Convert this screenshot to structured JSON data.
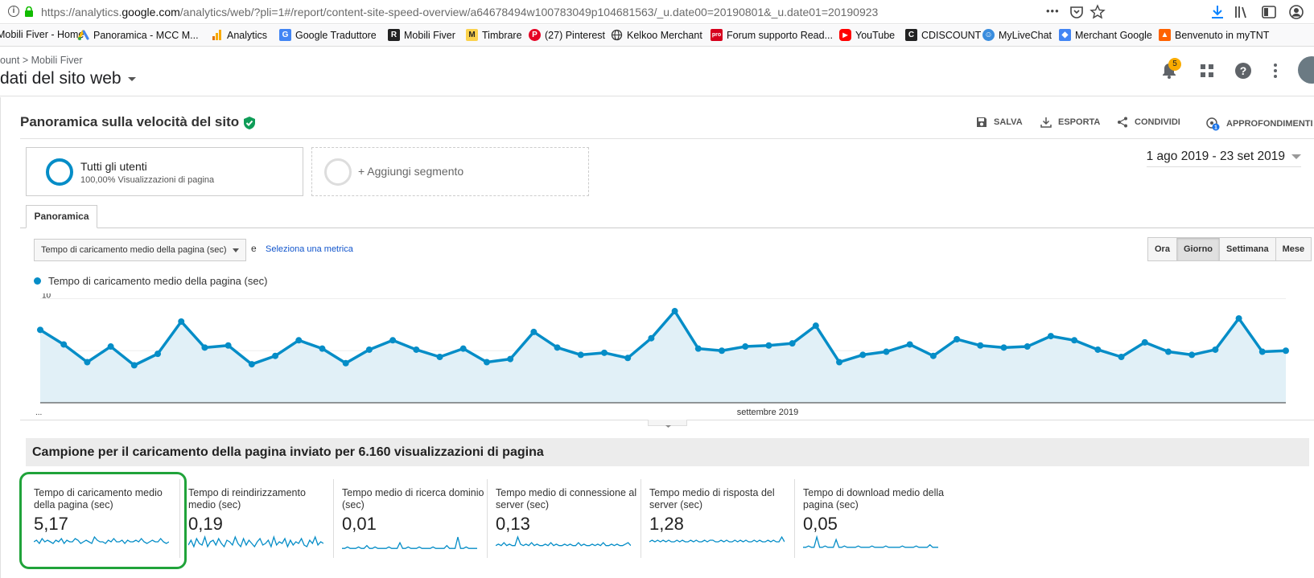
{
  "browser": {
    "url_prefix": "https://analytics.",
    "url_domain": "google.com",
    "url_rest": "/analytics/web/?pli=1#/report/content-site-speed-overview/a64678494w100783049p104681563/_u.date00=20190801&_u.date01=20190923",
    "menu_dots": "•••",
    "bookmarks": [
      {
        "label": "Mobili Fiver - Home",
        "icon": "mobili-icon"
      },
      {
        "label": "Panoramica - MCC M...",
        "icon": "google-ads-icon"
      },
      {
        "label": "Analytics",
        "icon": "analytics-icon"
      },
      {
        "label": "Google Traduttore",
        "icon": "translate-icon"
      },
      {
        "label": "Mobili Fiver",
        "icon": "mobili-icon"
      },
      {
        "label": "Timbrare",
        "icon": "timbrare-icon"
      },
      {
        "label": "(27) Pinterest",
        "icon": "pinterest-icon"
      },
      {
        "label": "Kelkoo Merchant",
        "icon": "globe-icon"
      },
      {
        "label": "Forum supporto Read...",
        "icon": "pro-icon"
      },
      {
        "label": "YouTube",
        "icon": "youtube-icon"
      },
      {
        "label": "CDISCOUNT",
        "icon": "cdiscount-icon"
      },
      {
        "label": "MyLiveChat",
        "icon": "mylivechat-icon"
      },
      {
        "label": "Merchant Google",
        "icon": "merchant-icon"
      },
      {
        "label": "Benvenuto in myTNT",
        "icon": "tnt-icon"
      }
    ]
  },
  "header": {
    "breadcrumb_account": "ount",
    "breadcrumb_property": "Mobili Fiver",
    "view_title": "dati del sito web",
    "notification_count": "5"
  },
  "report": {
    "title": "Panoramica sulla velocità del sito",
    "actions": {
      "save": "SALVA",
      "export": "ESPORTA",
      "share": "CONDIVIDI",
      "insights": "APPROFONDIMENTI"
    },
    "segment": {
      "name": "Tutti gli utenti",
      "subtitle": "100,00% Visualizzazioni di pagina"
    },
    "add_segment": "+ Aggiungi segmento",
    "date_range": "1 ago 2019 - 23 set 2019",
    "tab": "Panoramica",
    "metric_selector": "Tempo di caricamento medio della pagina (sec)",
    "and_text": "e",
    "select_metric": "Seleziona una metrica",
    "granularity": [
      "Ora",
      "Giorno",
      "Settimana",
      "Mese"
    ],
    "granularity_selected": "Giorno",
    "legend_label": "Tempo di caricamento medio della pagina (sec)",
    "sample_title": "Campione per il caricamento della pagina inviato per 6.160 visualizzazioni di pagina"
  },
  "colors": {
    "series": "#058dc7",
    "area_fill": "#e1f0f7",
    "highlight_border": "#20a33a"
  },
  "chart_data": {
    "type": "area",
    "series": [
      {
        "name": "Tempo di caricamento medio della pagina (sec)",
        "values": [
          7.0,
          5.6,
          3.9,
          5.4,
          3.6,
          4.7,
          7.8,
          5.3,
          5.5,
          3.7,
          4.5,
          6.0,
          5.2,
          3.8,
          5.1,
          6.0,
          5.1,
          4.4,
          5.2,
          3.9,
          4.2,
          6.8,
          5.3,
          4.6,
          4.8,
          4.3,
          6.2,
          8.8,
          5.2,
          5.0,
          5.4,
          5.5,
          5.7,
          7.4,
          3.9,
          4.6,
          4.9,
          5.6,
          4.5,
          6.1,
          5.5,
          5.3,
          5.4,
          6.4,
          6.0,
          5.1,
          4.4,
          5.8,
          4.9,
          4.6,
          5.1,
          8.1,
          4.9,
          5.0
        ]
      }
    ],
    "y_ticks": [
      "10",
      "5"
    ],
    "ylim": [
      0,
      10.5
    ],
    "x_labels": [
      "...",
      "settembre 2019"
    ],
    "grid": true
  },
  "scorecards": [
    {
      "title": "Tempo di caricamento medio della pagina (sec)",
      "value": "5,17",
      "spark": [
        5,
        6,
        4,
        7,
        5,
        6,
        5,
        4,
        6,
        5,
        7,
        4,
        6,
        5,
        5,
        7,
        6,
        4,
        5,
        6,
        5,
        4,
        8,
        6,
        5,
        5,
        4,
        6,
        5,
        7,
        5,
        5,
        6,
        4,
        6,
        5,
        5,
        6,
        5,
        7,
        5,
        4,
        5,
        6,
        5,
        5,
        7,
        5,
        4,
        5
      ]
    },
    {
      "title": "Tempo di reindirizzamento medio (sec)",
      "value": "0,19",
      "spark": [
        3,
        6,
        2,
        7,
        4,
        3,
        8,
        2,
        5,
        6,
        3,
        7,
        4,
        2,
        6,
        5,
        3,
        8,
        4,
        2,
        7,
        3,
        6,
        4,
        2,
        5,
        7,
        3,
        4,
        6,
        2,
        8,
        3,
        5,
        4,
        7,
        2,
        6,
        3,
        5,
        4,
        7,
        3,
        2,
        6,
        4,
        8,
        3,
        5,
        4
      ]
    },
    {
      "title": "Tempo medio di ricerca dominio (sec)",
      "value": "0,01",
      "spark": [
        1,
        1,
        2,
        1,
        1,
        1,
        2,
        1,
        1,
        3,
        1,
        1,
        2,
        1,
        1,
        1,
        1,
        2,
        1,
        1,
        1,
        5,
        1,
        1,
        2,
        1,
        1,
        1,
        2,
        1,
        1,
        1,
        1,
        2,
        1,
        1,
        1,
        1,
        3,
        1,
        1,
        1,
        9,
        1,
        1,
        2,
        1,
        1,
        1,
        1
      ]
    },
    {
      "title": "Tempo medio di connessione al server (sec)",
      "value": "0,13",
      "spark": [
        3,
        4,
        3,
        5,
        3,
        4,
        3,
        3,
        9,
        4,
        3,
        4,
        3,
        5,
        3,
        4,
        3,
        3,
        4,
        3,
        5,
        3,
        4,
        3,
        3,
        4,
        3,
        4,
        3,
        3,
        5,
        3,
        4,
        3,
        3,
        4,
        3,
        4,
        3,
        5,
        3,
        3,
        4,
        3,
        4,
        3,
        3,
        4,
        5,
        3
      ]
    },
    {
      "title": "Tempo medio di risposta del server (sec)",
      "value": "1,28",
      "spark": [
        5,
        6,
        5,
        6,
        5,
        6,
        5,
        6,
        5,
        5,
        6,
        5,
        6,
        5,
        5,
        6,
        5,
        6,
        5,
        5,
        6,
        5,
        6,
        6,
        5,
        5,
        6,
        5,
        6,
        5,
        5,
        6,
        5,
        6,
        5,
        6,
        5,
        5,
        6,
        5,
        6,
        5,
        5,
        6,
        5,
        6,
        5,
        5,
        8,
        5
      ]
    },
    {
      "title": "Tempo di download medio della pagina (sec)",
      "value": "0,05",
      "spark": [
        2,
        2,
        3,
        2,
        2,
        10,
        2,
        2,
        3,
        2,
        2,
        2,
        8,
        2,
        2,
        3,
        2,
        2,
        2,
        2,
        3,
        2,
        2,
        2,
        2,
        3,
        2,
        2,
        2,
        2,
        3,
        2,
        2,
        2,
        2,
        2,
        3,
        2,
        2,
        2,
        2,
        3,
        2,
        2,
        2,
        2,
        4,
        2,
        2,
        2
      ]
    }
  ]
}
